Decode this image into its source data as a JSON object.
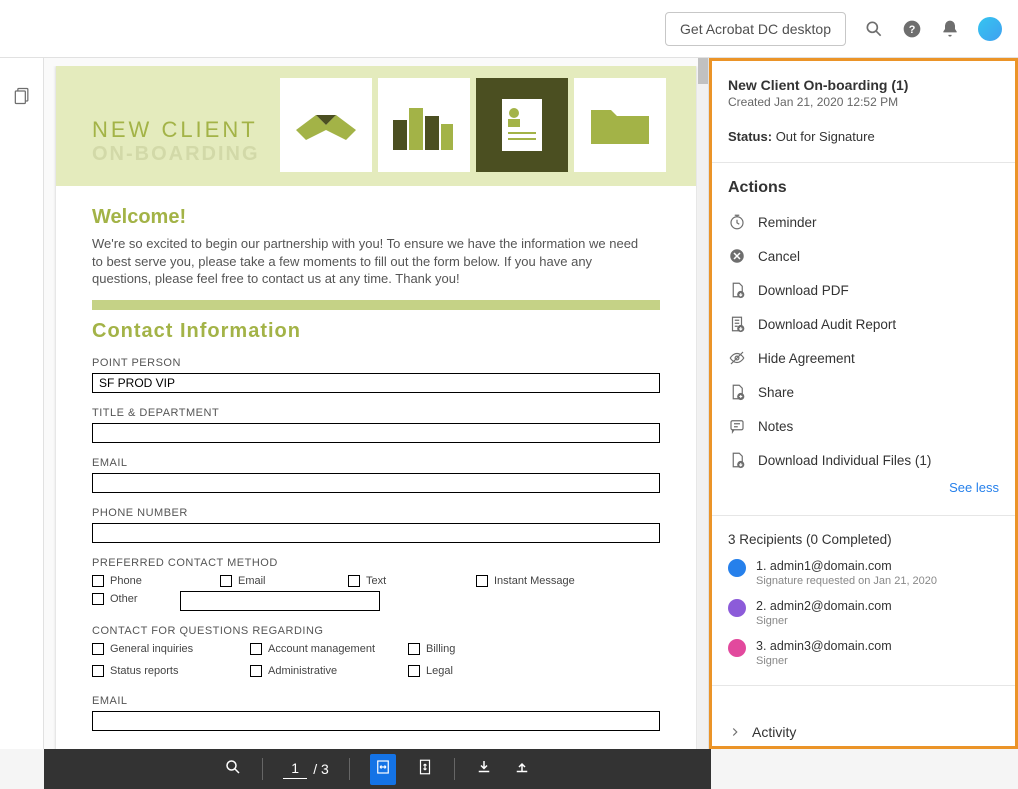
{
  "topbar": {
    "get_desktop": "Get Acrobat DC desktop"
  },
  "doc": {
    "header_title": "NEW CLIENT",
    "header_sub": "ON-BOARDING",
    "welcome": "Welcome!",
    "intro": "We're so excited to begin our partnership with you! To ensure we have the information we need to best serve you, please take a few moments to fill out the form below. If you have any questions, please feel free to contact us at any time. Thank you!",
    "contact_info": "Contact Information",
    "labels": {
      "point_person": "POINT PERSON",
      "title_dept": "TITLE & DEPARTMENT",
      "email": "EMAIL",
      "phone_number": "PHONE NUMBER",
      "pref_contact": "PREFERRED CONTACT METHOD",
      "contact_q": "CONTACT FOR QUESTIONS REGARDING",
      "email2": "EMAIL"
    },
    "values": {
      "point_person": "SF PROD VIP"
    },
    "pref_options": {
      "phone": "Phone",
      "email": "Email",
      "text": "Text",
      "im": "Instant Message",
      "other": "Other"
    },
    "q_options": {
      "general": "General inquiries",
      "acct": "Account management",
      "billing": "Billing",
      "status": "Status reports",
      "admin": "Administrative",
      "legal": "Legal"
    }
  },
  "bottombar": {
    "current_page": "1",
    "total_pages": "/ 3"
  },
  "panel": {
    "title": "New Client On-boarding (1)",
    "created": "Created Jan 21, 2020 12:52 PM",
    "status_label": "Status:",
    "status_value": "Out for Signature",
    "actions_header": "Actions",
    "actions": {
      "reminder": "Reminder",
      "cancel": "Cancel",
      "download_pdf": "Download PDF",
      "download_audit": "Download Audit Report",
      "hide_agreement": "Hide Agreement",
      "share": "Share",
      "notes": "Notes",
      "download_individual": "Download Individual Files (1)"
    },
    "see_less": "See less",
    "recipients_header": "3 Recipients (0 Completed)",
    "recipients": [
      {
        "label": "1. admin1@domain.com",
        "meta": "Signature requested on Jan 21, 2020",
        "color": "#2680eb"
      },
      {
        "label": "2. admin2@domain.com",
        "meta": "Signer",
        "color": "#8c5bd9"
      },
      {
        "label": "3. admin3@domain.com",
        "meta": "Signer",
        "color": "#e2499d"
      }
    ],
    "activity": "Activity"
  }
}
